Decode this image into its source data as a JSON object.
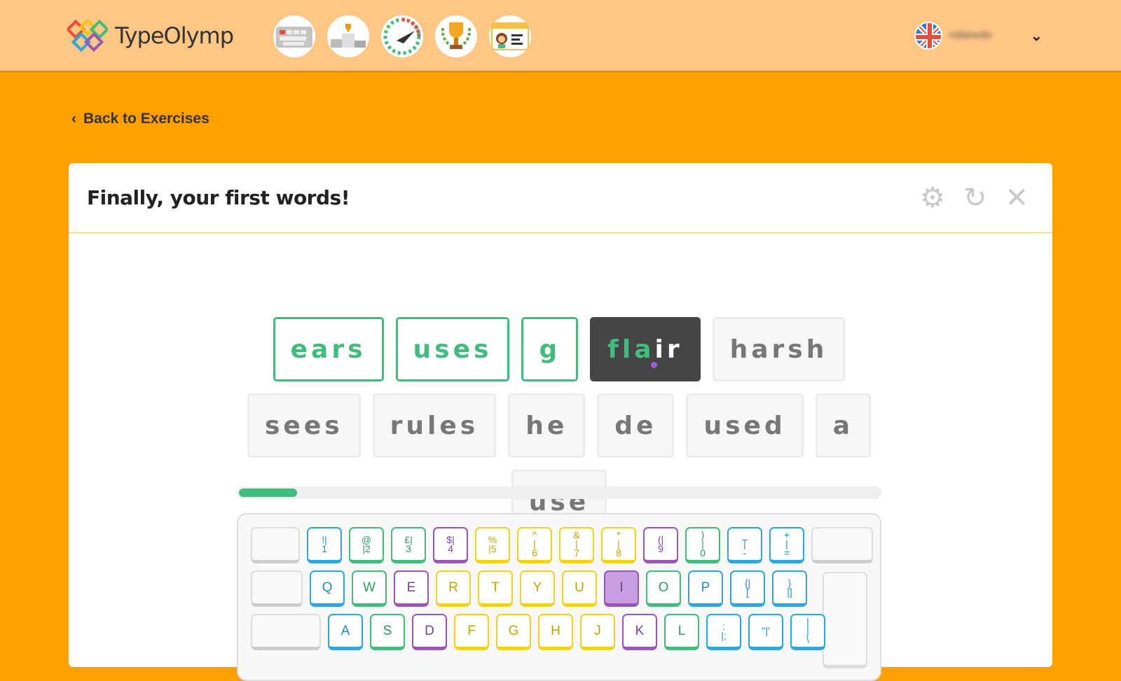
{
  "brand": {
    "name": "TypeOlymp"
  },
  "nav": [
    {
      "icon": "keyboard-icon",
      "label": "Lessons"
    },
    {
      "icon": "podium-icon",
      "label": "Ranking"
    },
    {
      "icon": "speedometer-icon",
      "label": "Speed test"
    },
    {
      "icon": "trophy-icon",
      "label": "Achievements"
    },
    {
      "icon": "profile-card-icon",
      "label": "Profile"
    }
  ],
  "user": {
    "name": "robinvdv",
    "language": "English (UK)"
  },
  "back_label": "Back to Exercises",
  "exercise": {
    "title": "Finally, your first words!"
  },
  "words": [
    {
      "text": "ears",
      "state": "done"
    },
    {
      "text": "uses",
      "state": "done"
    },
    {
      "text": "g",
      "state": "done"
    },
    {
      "typed": "fla",
      "rest": "ir",
      "state": "current"
    },
    {
      "text": "harsh",
      "state": "pending"
    },
    {
      "text": "sees",
      "state": "pending"
    },
    {
      "text": "rules",
      "state": "pending"
    },
    {
      "text": "he",
      "state": "pending"
    },
    {
      "text": "de",
      "state": "pending"
    },
    {
      "text": "used",
      "state": "pending"
    },
    {
      "text": "a",
      "state": "pending"
    },
    {
      "text": "use",
      "state": "pending"
    }
  ],
  "progress_percent": 9,
  "active_key": "I",
  "keyboard": [
    [
      [
        "",
        "blank",
        70
      ],
      [
        "!|1",
        "blue"
      ],
      [
        "@|2",
        "green"
      ],
      [
        "£|3",
        "green"
      ],
      [
        "$|4",
        "purple"
      ],
      [
        "%|5",
        "yellow"
      ],
      [
        "^|6",
        "yellow"
      ],
      [
        "&|7",
        "yellow"
      ],
      [
        "*|8",
        "yellow"
      ],
      [
        "(|9",
        "purple"
      ],
      [
        ")|0",
        "green"
      ],
      [
        "_|-",
        "blue"
      ],
      [
        "+|=",
        "blue"
      ],
      [
        "",
        "blank",
        88
      ]
    ],
    [
      [
        "",
        "blank",
        74
      ],
      [
        "Q",
        "blue"
      ],
      [
        "W",
        "green"
      ],
      [
        "E",
        "purple"
      ],
      [
        "R",
        "yellow"
      ],
      [
        "T",
        "yellow"
      ],
      [
        "Y",
        "yellow"
      ],
      [
        "U",
        "yellow"
      ],
      [
        "I",
        "purple"
      ],
      [
        "O",
        "green"
      ],
      [
        "P",
        "blue"
      ],
      [
        "{|[",
        "blue"
      ],
      [
        "}|]",
        "blue"
      ]
    ],
    [
      [
        "",
        "blank",
        100
      ],
      [
        "A",
        "blue"
      ],
      [
        "S",
        "green"
      ],
      [
        "D",
        "purple"
      ],
      [
        "F",
        "yellow"
      ],
      [
        "G",
        "yellow"
      ],
      [
        "H",
        "yellow"
      ],
      [
        "J",
        "yellow"
      ],
      [
        "K",
        "purple"
      ],
      [
        "L",
        "green"
      ],
      [
        ":|;",
        "blue"
      ],
      [
        "\"|'",
        "blue"
      ],
      [
        "||\\",
        "blue"
      ]
    ]
  ],
  "colors": {
    "accent": "#ff9f00",
    "correct": "#3ebd7c",
    "cursor": "#a35bd3"
  }
}
